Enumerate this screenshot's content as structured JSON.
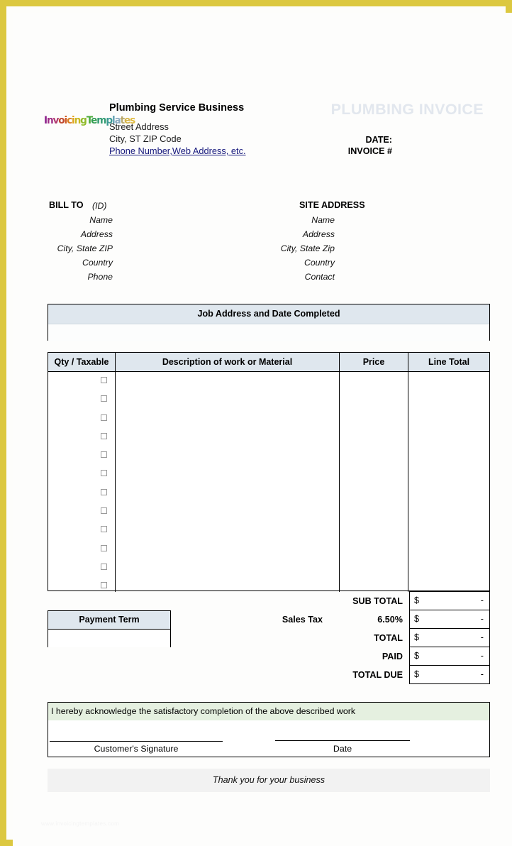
{
  "page": {
    "border_color": "#dcc840",
    "background": "#fdfdfc",
    "watermark": "www.invoicingtemplates.com"
  },
  "header": {
    "logo": {
      "name": "invoicing-templates-logo",
      "text": "InvoicingTemplates",
      "letters": [
        {
          "ch": "I",
          "color": "#8a1f8a"
        },
        {
          "ch": "n",
          "color": "#9e2b86"
        },
        {
          "ch": "v",
          "color": "#b03a6f"
        },
        {
          "ch": "o",
          "color": "#c0492f"
        },
        {
          "ch": "i",
          "color": "#cf5a22"
        },
        {
          "ch": "c",
          "color": "#d97b1b"
        },
        {
          "ch": "i",
          "color": "#e0a31c"
        },
        {
          "ch": "n",
          "color": "#c9b822"
        },
        {
          "ch": "g",
          "color": "#8fbb2b"
        },
        {
          "ch": "T",
          "color": "#4aa93a"
        },
        {
          "ch": "e",
          "color": "#2f9c4e"
        },
        {
          "ch": "m",
          "color": "#309a70"
        },
        {
          "ch": "p",
          "color": "#3c9a93"
        },
        {
          "ch": "l",
          "color": "#5f9fb2"
        },
        {
          "ch": "a",
          "color": "#8aa9c0"
        },
        {
          "ch": "t",
          "color": "#b9a96c"
        },
        {
          "ch": "e",
          "color": "#d4b245"
        },
        {
          "ch": "s",
          "color": "#e0bb3f"
        }
      ]
    },
    "business_name": "Plumbing Service Business",
    "street_address": "Street Address",
    "city_state_zip": "City, ST  ZIP Code",
    "contact_link": "Phone Number,Web Address, etc.",
    "doc_title": "PLUMBING INVOICE",
    "doc_title_color": "#e2e7ee",
    "date_label": "DATE:",
    "invoice_label": "INVOICE #"
  },
  "bill_to": {
    "heading": "BILL TO",
    "id_label": "(ID)",
    "rows": [
      "Name",
      "Address",
      "City, State ZIP",
      "Country",
      "Phone"
    ]
  },
  "site_address": {
    "heading": "SITE ADDRESS",
    "rows": [
      "Name",
      "Address",
      "City, State Zip",
      "Country",
      "Contact"
    ]
  },
  "job_section": {
    "title": "Job Address and Date Completed",
    "header_bg": "#dfe7ee"
  },
  "items_table": {
    "columns": [
      "Qty / Taxable",
      "Description of work or Material",
      "Price",
      "Line Total"
    ],
    "header_bg": "#dfe7ee",
    "row_count": 12,
    "rows": [
      {
        "taxable": false
      },
      {
        "taxable": false
      },
      {
        "taxable": false
      },
      {
        "taxable": false
      },
      {
        "taxable": false
      },
      {
        "taxable": false
      },
      {
        "taxable": false
      },
      {
        "taxable": false
      },
      {
        "taxable": false
      },
      {
        "taxable": false
      },
      {
        "taxable": false
      },
      {
        "taxable": false
      }
    ]
  },
  "payment_term": {
    "title": "Payment Term",
    "value": "",
    "header_bg": "#dfe7ee"
  },
  "totals": {
    "sales_tax_label": "Sales Tax",
    "sales_tax_rate": "6.50%",
    "currency": "$",
    "rows": [
      {
        "label": "SUB TOTAL",
        "currency": "$",
        "amount": "-"
      },
      {
        "label": "6.50%",
        "currency": "$",
        "amount": "-"
      },
      {
        "label": "TOTAL",
        "currency": "$",
        "amount": "-"
      },
      {
        "label": "PAID",
        "currency": "$",
        "amount": "-"
      },
      {
        "label": "TOTAL DUE",
        "currency": "$",
        "amount": "-"
      }
    ]
  },
  "acknowledgement": {
    "text": "I hereby acknowledge the satisfactory completion of the above described work",
    "band_bg": "#e5f0e0",
    "signature_caption": "Customer's Signature",
    "date_caption": "Date"
  },
  "footer": {
    "thanks": "Thank you for your business",
    "bg": "#f2f2f2"
  }
}
